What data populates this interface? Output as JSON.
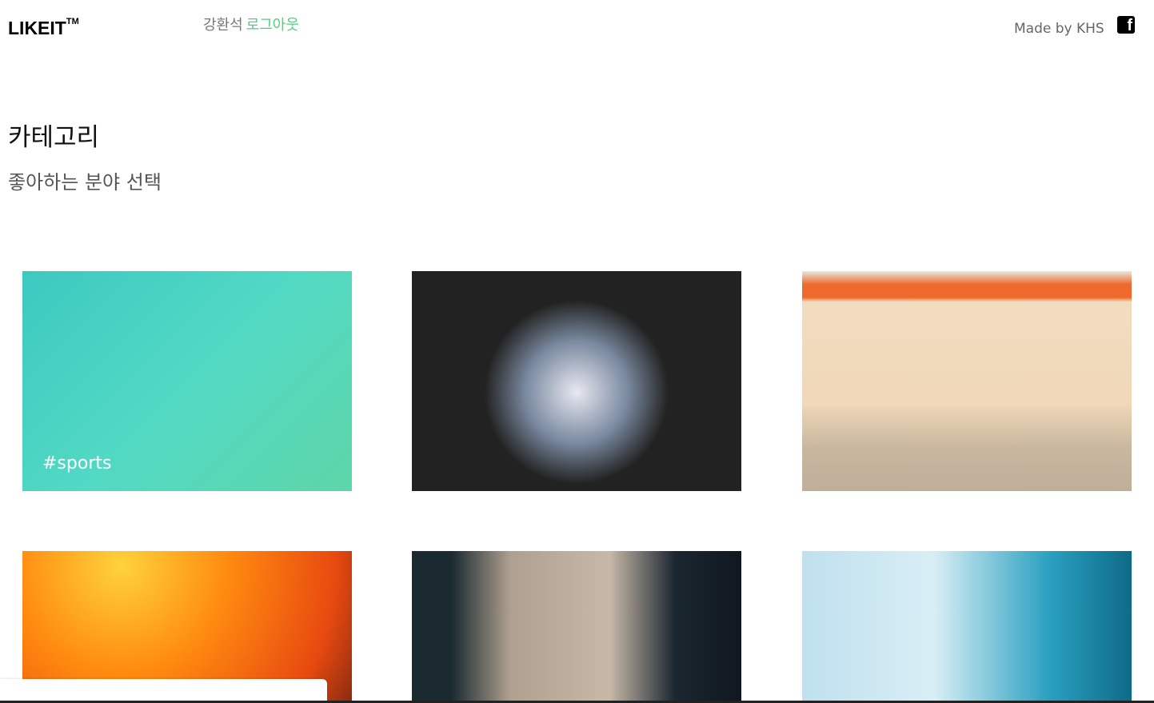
{
  "header": {
    "logo": "LIKEIT",
    "trademark": "TM",
    "username": "강환석",
    "logout": "로그아웃",
    "credit": "Made by KHS",
    "facebook_icon": "f"
  },
  "main": {
    "title": "카테고리",
    "subtitle": "좋아하는 분야 선택",
    "cards": [
      {
        "tag": "#sports"
      },
      {
        "tag": ""
      },
      {
        "tag": ""
      },
      {
        "tag": ""
      },
      {
        "tag": ""
      },
      {
        "tag": ""
      }
    ]
  }
}
